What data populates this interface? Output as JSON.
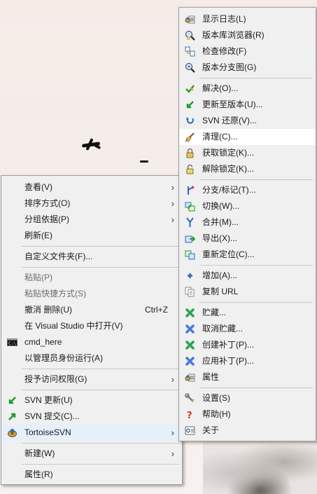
{
  "context_menu": {
    "items": [
      {
        "label": "查看(V)"
      },
      {
        "label": "排序方式(O)"
      },
      {
        "label": "分组依据(P)"
      },
      {
        "label": "刷新(E)"
      },
      {
        "label": "自定义文件夹(F)..."
      },
      {
        "label": "粘贴(P)"
      },
      {
        "label": "粘贴快捷方式(S)"
      },
      {
        "label": "撤消 删除(U)",
        "shortcut": "Ctrl+Z"
      },
      {
        "label": "在 Visual Studio 中打开(V)"
      },
      {
        "label": "cmd_here"
      },
      {
        "label": "以管理员身份运行(A)"
      },
      {
        "label": "授予访问权限(G)"
      },
      {
        "label": "SVN 更新(U)"
      },
      {
        "label": "SVN 提交(C)..."
      },
      {
        "label": "TortoiseSVN"
      },
      {
        "label": "新建(W)"
      },
      {
        "label": "属性(R)"
      }
    ]
  },
  "tortoise_submenu": {
    "items": [
      {
        "label": "显示日志(L)"
      },
      {
        "label": "版本库浏览器(R)"
      },
      {
        "label": "检查修改(F)"
      },
      {
        "label": "版本分支图(G)"
      },
      {
        "label": "解决(O)..."
      },
      {
        "label": "更新至版本(U)..."
      },
      {
        "label": "SVN 还原(V)..."
      },
      {
        "label": "清理(C)..."
      },
      {
        "label": "获取锁定(K)..."
      },
      {
        "label": "解除锁定(K)..."
      },
      {
        "label": "分支/标记(T)..."
      },
      {
        "label": "切换(W)..."
      },
      {
        "label": "合并(M)..."
      },
      {
        "label": "导出(X)..."
      },
      {
        "label": "重新定位(C)..."
      },
      {
        "label": "增加(A)..."
      },
      {
        "label": "复制 URL"
      },
      {
        "label": "贮藏..."
      },
      {
        "label": "取消贮藏..."
      },
      {
        "label": "创建补丁(P)..."
      },
      {
        "label": "应用补丁(P)..."
      },
      {
        "label": "属性"
      },
      {
        "label": "设置(S)"
      },
      {
        "label": "帮助(H)"
      },
      {
        "label": "关于"
      }
    ]
  }
}
